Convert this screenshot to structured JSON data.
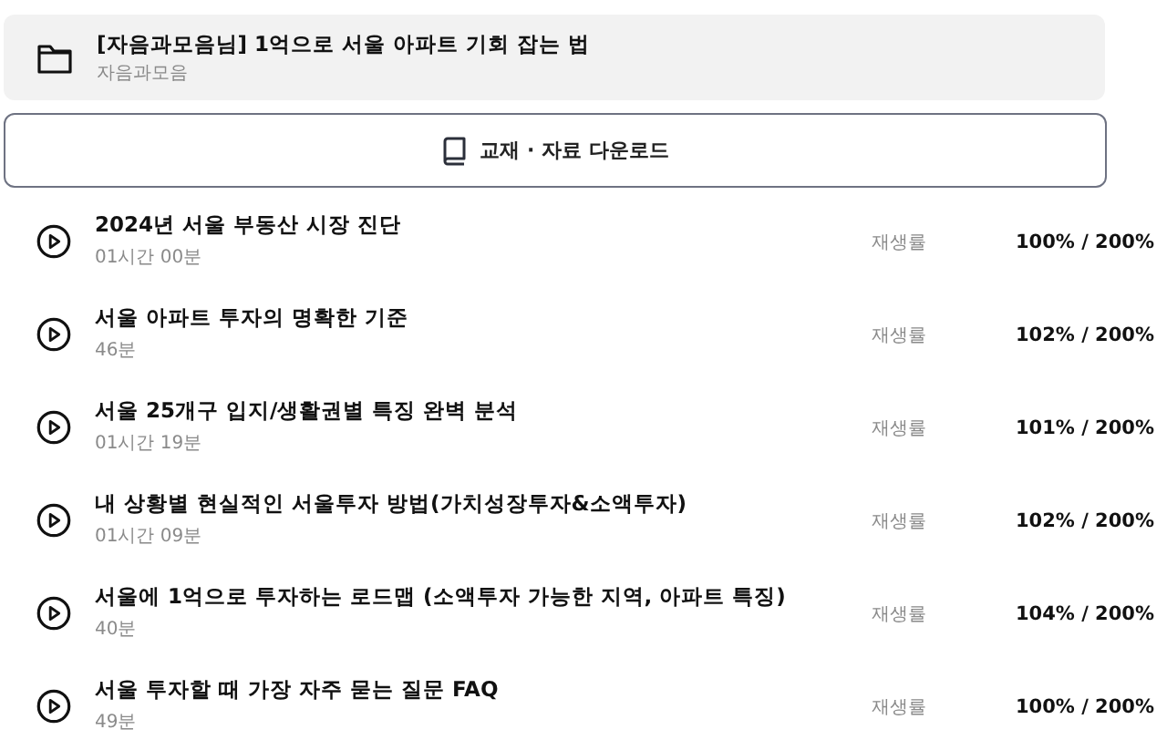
{
  "course": {
    "title": "[자음과모음님] 1억으로 서울 아파트 기회 잡는 법",
    "author": "자음과모음"
  },
  "download_button": {
    "label": "교재 · 자료 다운로드"
  },
  "lessons": [
    {
      "title": "2024년 서울 부동산 시장 진단",
      "duration": "01시간 00분",
      "rate_label": "재생률",
      "rate": "100% / 200%"
    },
    {
      "title": "서울 아파트 투자의 명확한 기준",
      "duration": "46분",
      "rate_label": "재생률",
      "rate": "102% / 200%"
    },
    {
      "title": "서울 25개구 입지/생활권별 특징 완벽 분석",
      "duration": "01시간 19분",
      "rate_label": "재생률",
      "rate": "101% / 200%"
    },
    {
      "title": "내 상황별 현실적인 서울투자 방법(가치성장투자&소액투자)",
      "duration": "01시간 09분",
      "rate_label": "재생률",
      "rate": "102% / 200%"
    },
    {
      "title": "서울에 1억으로 투자하는 로드맵 (소액투자 가능한 지역, 아파트 특징)",
      "duration": "40분",
      "rate_label": "재생률",
      "rate": "104% / 200%"
    },
    {
      "title": "서울 투자할 때 가장 자주 묻는 질문 FAQ",
      "duration": "49분",
      "rate_label": "재생률",
      "rate": "100% / 200%"
    }
  ]
}
